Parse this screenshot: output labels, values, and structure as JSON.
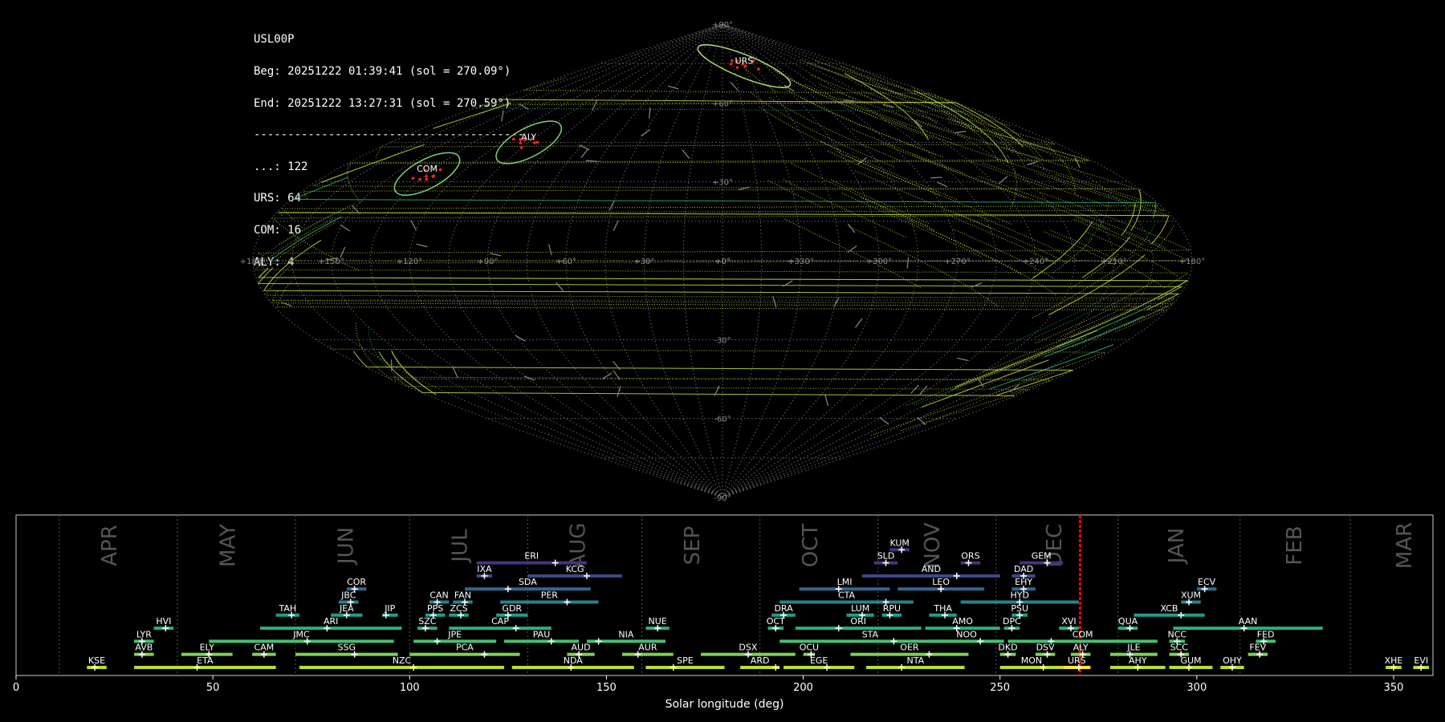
{
  "summary": {
    "lines": [
      "USL00P",
      "Beg: 20251222 01:39:41 (sol = 270.09°)",
      "End: 20251222 13:27:31 (sol = 270.59°)",
      "----------------------------------------",
      "...: 122",
      "URS: 64",
      "COM: 16",
      "ALY: 4"
    ]
  },
  "chart_data": [
    {
      "type": "scatter",
      "projection": "sinusoidal (sun-centered ecliptic)",
      "lat_ticks": [
        "+90°",
        "+60°",
        "+30°",
        "+0°",
        "-30°",
        "-60°",
        "-90°"
      ],
      "lon_ticks": [
        "+180°",
        "+150°",
        "+120°",
        "+90°",
        "+60°",
        "+30°",
        "+0°",
        "+330°",
        "+300°",
        "+270°",
        "+240°",
        "+210°",
        "+180°"
      ],
      "highlighted_showers": [
        {
          "code": "URS",
          "lon": 330,
          "lat": 74,
          "color": "#a8d86e"
        },
        {
          "code": "ALY",
          "lon": 105,
          "lat": 45,
          "color": "#7fd07a"
        },
        {
          "code": "COM",
          "lon": 135,
          "lat": 33,
          "color": "#7fd07a"
        }
      ],
      "meteor_colors": {
        "trail": "#c8e03a",
        "cluster": "#ff2020",
        "sporadic": "#888888",
        "shower": "#2fb47c"
      }
    },
    {
      "type": "range",
      "xlabel": "Solar longitude (deg)",
      "xlim": [
        0,
        360
      ],
      "xticks": [
        0,
        50,
        100,
        150,
        200,
        250,
        300,
        350
      ],
      "current_sol": [
        270.09,
        270.59
      ],
      "month_boundaries": [
        11,
        41,
        71,
        100,
        130,
        159,
        189,
        219,
        249,
        280,
        311,
        339
      ],
      "month_labels": [
        {
          "label": "APR",
          "x": 24
        },
        {
          "label": "MAY",
          "x": 54
        },
        {
          "label": "JUN",
          "x": 84
        },
        {
          "label": "JUL",
          "x": 113
        },
        {
          "label": "AUG",
          "x": 143
        },
        {
          "label": "SEP",
          "x": 172
        },
        {
          "label": "OCT",
          "x": 202
        },
        {
          "label": "NOV",
          "x": 233
        },
        {
          "label": "DEC",
          "x": 264
        },
        {
          "label": "JAN",
          "x": 295
        },
        {
          "label": "FEB",
          "x": 325
        },
        {
          "label": "MAR",
          "x": 353
        }
      ],
      "showers": [
        {
          "code": "KUM",
          "start": 222,
          "end": 227,
          "peak": 225,
          "row": 10,
          "color": "#46337f"
        },
        {
          "code": "ERI",
          "start": 117,
          "end": 145,
          "peak": 137,
          "row": 9,
          "color": "#46337f"
        },
        {
          "code": "SLD",
          "start": 218,
          "end": 224,
          "peak": 221,
          "row": 9,
          "color": "#46337f"
        },
        {
          "code": "ORS",
          "start": 240,
          "end": 245,
          "peak": 242,
          "row": 9,
          "color": "#46337f"
        },
        {
          "code": "GEM",
          "start": 255,
          "end": 266,
          "peak": 262,
          "row": 9,
          "color": "#46337f"
        },
        {
          "code": "IXA",
          "start": 117,
          "end": 121,
          "peak": 119,
          "row": 8,
          "color": "#3e4989"
        },
        {
          "code": "KCG",
          "start": 130,
          "end": 154,
          "peak": 145,
          "row": 8,
          "color": "#3e4989"
        },
        {
          "code": "AND",
          "start": 215,
          "end": 250,
          "peak": 239,
          "row": 8,
          "color": "#3e4989"
        },
        {
          "code": "DAD",
          "start": 253,
          "end": 259,
          "peak": 256,
          "row": 8,
          "color": "#3e4989"
        },
        {
          "code": "COR",
          "start": 84,
          "end": 89,
          "peak": 86,
          "row": 7,
          "color": "#31688e"
        },
        {
          "code": "SDA",
          "start": 114,
          "end": 146,
          "peak": 125,
          "row": 7,
          "color": "#31688e"
        },
        {
          "code": "LMI",
          "start": 199,
          "end": 222,
          "peak": 209,
          "row": 7,
          "color": "#31688e"
        },
        {
          "code": "LEO",
          "start": 224,
          "end": 246,
          "peak": 235,
          "row": 7,
          "color": "#31688e"
        },
        {
          "code": "EHY",
          "start": 253,
          "end": 259,
          "peak": 256,
          "row": 7,
          "color": "#31688e"
        },
        {
          "code": "ECV",
          "start": 300,
          "end": 305,
          "peak": 302,
          "row": 7,
          "color": "#31688e"
        },
        {
          "code": "JBC",
          "start": 82,
          "end": 87,
          "peak": 85,
          "row": 6,
          "color": "#26828e"
        },
        {
          "code": "CAN",
          "start": 105,
          "end": 110,
          "peak": 107,
          "row": 6,
          "color": "#26828e"
        },
        {
          "code": "FAN",
          "start": 111,
          "end": 116,
          "peak": 114,
          "row": 6,
          "color": "#26828e"
        },
        {
          "code": "PER",
          "start": 123,
          "end": 148,
          "peak": 140,
          "row": 6,
          "color": "#26828e"
        },
        {
          "code": "CTA",
          "start": 194,
          "end": 228,
          "peak": 221,
          "row": 6,
          "color": "#26828e"
        },
        {
          "code": "HYD",
          "start": 240,
          "end": 270,
          "peak": 255,
          "row": 6,
          "color": "#26828e"
        },
        {
          "code": "XUM",
          "start": 296,
          "end": 301,
          "peak": 298,
          "row": 6,
          "color": "#26828e"
        },
        {
          "code": "TAH",
          "start": 66,
          "end": 72,
          "peak": 70,
          "row": 5,
          "color": "#1f9e89"
        },
        {
          "code": "JEA",
          "start": 80,
          "end": 88,
          "peak": 84,
          "row": 5,
          "color": "#1f9e89"
        },
        {
          "code": "JIP",
          "start": 93,
          "end": 97,
          "peak": 94,
          "row": 5,
          "color": "#1f9e89"
        },
        {
          "code": "PPS",
          "start": 104,
          "end": 109,
          "peak": 106,
          "row": 5,
          "color": "#1f9e89"
        },
        {
          "code": "ZCS",
          "start": 110,
          "end": 115,
          "peak": 113,
          "row": 5,
          "color": "#1f9e89"
        },
        {
          "code": "GDR",
          "start": 122,
          "end": 130,
          "peak": 125,
          "row": 5,
          "color": "#1f9e89"
        },
        {
          "code": "DRA",
          "start": 192,
          "end": 198,
          "peak": 195,
          "row": 5,
          "color": "#1f9e89"
        },
        {
          "code": "LUM",
          "start": 211,
          "end": 218,
          "peak": 215,
          "row": 5,
          "color": "#1f9e89"
        },
        {
          "code": "RPU",
          "start": 220,
          "end": 225,
          "peak": 222,
          "row": 5,
          "color": "#1f9e89"
        },
        {
          "code": "THA",
          "start": 232,
          "end": 239,
          "peak": 236,
          "row": 5,
          "color": "#1f9e89"
        },
        {
          "code": "PSU",
          "start": 253,
          "end": 257,
          "peak": 255,
          "row": 5,
          "color": "#1f9e89"
        },
        {
          "code": "XCB",
          "start": 284,
          "end": 302,
          "peak": 296,
          "row": 5,
          "color": "#1f9e89"
        },
        {
          "code": "HVI",
          "start": 35,
          "end": 40,
          "peak": 38,
          "row": 4,
          "color": "#2ab07f"
        },
        {
          "code": "ARI",
          "start": 62,
          "end": 98,
          "peak": 79,
          "row": 4,
          "color": "#2ab07f"
        },
        {
          "code": "SZC",
          "start": 102,
          "end": 107,
          "peak": 104,
          "row": 4,
          "color": "#2ab07f"
        },
        {
          "code": "CAP",
          "start": 110,
          "end": 136,
          "peak": 127,
          "row": 4,
          "color": "#2ab07f"
        },
        {
          "code": "NUE",
          "start": 160,
          "end": 166,
          "peak": 163,
          "row": 4,
          "color": "#2ab07f"
        },
        {
          "code": "OCT",
          "start": 191,
          "end": 195,
          "peak": 193,
          "row": 4,
          "color": "#2ab07f"
        },
        {
          "code": "ORI",
          "start": 198,
          "end": 230,
          "peak": 209,
          "row": 4,
          "color": "#2ab07f"
        },
        {
          "code": "AMO",
          "start": 231,
          "end": 250,
          "peak": 239,
          "row": 4,
          "color": "#2ab07f"
        },
        {
          "code": "DPC",
          "start": 251,
          "end": 255,
          "peak": 253,
          "row": 4,
          "color": "#2ab07f"
        },
        {
          "code": "XVI",
          "start": 265,
          "end": 270,
          "peak": 268,
          "row": 4,
          "color": "#2ab07f"
        },
        {
          "code": "QUA",
          "start": 280,
          "end": 285,
          "peak": 283,
          "row": 4,
          "color": "#2ab07f"
        },
        {
          "code": "AAN",
          "start": 294,
          "end": 332,
          "peak": 312,
          "row": 4,
          "color": "#2ab07f"
        },
        {
          "code": "LYR",
          "start": 30,
          "end": 35,
          "peak": 32,
          "row": 3,
          "color": "#44bf70"
        },
        {
          "code": "JMC",
          "start": 49,
          "end": 96,
          "peak": 74,
          "row": 3,
          "color": "#44bf70"
        },
        {
          "code": "JPE",
          "start": 101,
          "end": 122,
          "peak": 107,
          "row": 3,
          "color": "#44bf70"
        },
        {
          "code": "PAU",
          "start": 124,
          "end": 143,
          "peak": 136,
          "row": 3,
          "color": "#44bf70"
        },
        {
          "code": "NIA",
          "start": 145,
          "end": 165,
          "peak": 148,
          "row": 3,
          "color": "#44bf70"
        },
        {
          "code": "STA",
          "start": 194,
          "end": 240,
          "peak": 223,
          "row": 3,
          "color": "#44bf70"
        },
        {
          "code": "NOO",
          "start": 232,
          "end": 251,
          "peak": 245,
          "row": 3,
          "color": "#44bf70"
        },
        {
          "code": "COM",
          "start": 252,
          "end": 290,
          "peak": 263,
          "row": 3,
          "color": "#44bf70"
        },
        {
          "code": "NCC",
          "start": 293,
          "end": 297,
          "peak": 295,
          "row": 3,
          "color": "#44bf70"
        },
        {
          "code": "FED",
          "start": 315,
          "end": 320,
          "peak": 317,
          "row": 3,
          "color": "#44bf70"
        },
        {
          "code": "AVB",
          "start": 30,
          "end": 35,
          "peak": 32,
          "row": 2,
          "color": "#7ad151"
        },
        {
          "code": "ELY",
          "start": 42,
          "end": 55,
          "peak": 49,
          "row": 2,
          "color": "#7ad151"
        },
        {
          "code": "CAM",
          "start": 60,
          "end": 66,
          "peak": 63,
          "row": 2,
          "color": "#7ad151"
        },
        {
          "code": "SSG",
          "start": 71,
          "end": 97,
          "peak": 86,
          "row": 2,
          "color": "#7ad151"
        },
        {
          "code": "PCA",
          "start": 100,
          "end": 128,
          "peak": 119,
          "row": 2,
          "color": "#7ad151"
        },
        {
          "code": "AUD",
          "start": 140,
          "end": 147,
          "peak": 143,
          "row": 2,
          "color": "#7ad151"
        },
        {
          "code": "AUR",
          "start": 154,
          "end": 167,
          "peak": 158,
          "row": 2,
          "color": "#7ad151"
        },
        {
          "code": "DSX",
          "start": 174,
          "end": 198,
          "peak": 186,
          "row": 2,
          "color": "#7ad151"
        },
        {
          "code": "OCU",
          "start": 200,
          "end": 203,
          "peak": 202,
          "row": 2,
          "color": "#7ad151"
        },
        {
          "code": "OER",
          "start": 212,
          "end": 242,
          "peak": 232,
          "row": 2,
          "color": "#7ad151"
        },
        {
          "code": "DKD",
          "start": 250,
          "end": 254,
          "peak": 252,
          "row": 2,
          "color": "#7ad151"
        },
        {
          "code": "DSV",
          "start": 259,
          "end": 264,
          "peak": 262,
          "row": 2,
          "color": "#7ad151"
        },
        {
          "code": "ALY",
          "start": 268,
          "end": 273,
          "peak": 271,
          "row": 2,
          "color": "#7ad151"
        },
        {
          "code": "JLE",
          "start": 278,
          "end": 290,
          "peak": 283,
          "row": 2,
          "color": "#7ad151"
        },
        {
          "code": "SCC",
          "start": 293,
          "end": 298,
          "peak": 296,
          "row": 2,
          "color": "#7ad151"
        },
        {
          "code": "FEV",
          "start": 313,
          "end": 318,
          "peak": 316,
          "row": 2,
          "color": "#7ad151"
        },
        {
          "code": "KSE",
          "start": 18,
          "end": 23,
          "peak": 20,
          "row": 1,
          "color": "#bddf26"
        },
        {
          "code": "ETA",
          "start": 30,
          "end": 66,
          "peak": 46,
          "row": 1,
          "color": "#bddf26"
        },
        {
          "code": "NZC",
          "start": 72,
          "end": 124,
          "peak": 101,
          "row": 1,
          "color": "#bddf26"
        },
        {
          "code": "NDA",
          "start": 126,
          "end": 157,
          "peak": 141,
          "row": 1,
          "color": "#bddf26"
        },
        {
          "code": "SPE",
          "start": 160,
          "end": 180,
          "peak": 167,
          "row": 1,
          "color": "#bddf26"
        },
        {
          "code": "ARD",
          "start": 184,
          "end": 194,
          "peak": 193,
          "row": 1,
          "color": "#bddf26"
        },
        {
          "code": "EGE",
          "start": 195,
          "end": 213,
          "peak": 206,
          "row": 1,
          "color": "#bddf26"
        },
        {
          "code": "NTA",
          "start": 216,
          "end": 241,
          "peak": 225,
          "row": 1,
          "color": "#bddf26"
        },
        {
          "code": "MON",
          "start": 250,
          "end": 266,
          "peak": 261,
          "row": 1,
          "color": "#bddf26"
        },
        {
          "code": "URS",
          "start": 266,
          "end": 273,
          "peak": 270,
          "row": 1,
          "color": "#fde725"
        },
        {
          "code": "AHY",
          "start": 278,
          "end": 292,
          "peak": 285,
          "row": 1,
          "color": "#bddf26"
        },
        {
          "code": "GUM",
          "start": 293,
          "end": 304,
          "peak": 298,
          "row": 1,
          "color": "#bddf26"
        },
        {
          "code": "OHY",
          "start": 306,
          "end": 312,
          "peak": 309,
          "row": 1,
          "color": "#bddf26"
        },
        {
          "code": "XHE",
          "start": 348,
          "end": 352,
          "peak": 350,
          "row": 1,
          "color": "#bddf26"
        },
        {
          "code": "EVI",
          "start": 355,
          "end": 359,
          "peak": 357,
          "row": 1,
          "color": "#bddf26"
        }
      ]
    }
  ]
}
